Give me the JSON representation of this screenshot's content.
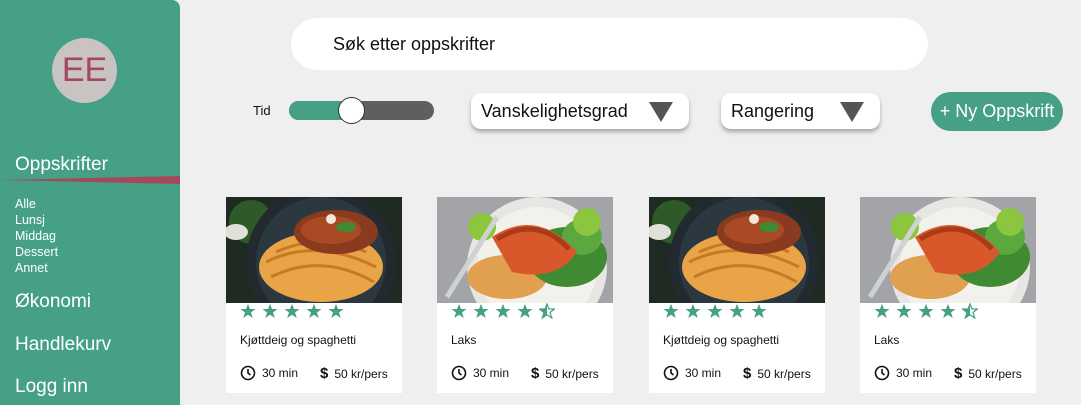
{
  "user": {
    "initials": "EE"
  },
  "colors": {
    "accent": "#45a085",
    "active_line": "#a6485c",
    "avatar_bg": "#c9c3c3"
  },
  "sidebar": {
    "main_items": [
      "Oppskrifter",
      "Økonomi",
      "Handlekurv",
      "Logg inn"
    ],
    "active": "Oppskrifter",
    "sub_items": [
      "Alle",
      "Lunsj",
      "Middag",
      "Dessert",
      "Annet"
    ]
  },
  "search": {
    "placeholder": "Søk etter oppskrifter"
  },
  "filters": {
    "time_label": "Tid",
    "time_slider_value": 0.43,
    "difficulty_label": "Vanskelighetsgrad",
    "rating_label": "Rangering"
  },
  "new_recipe_button": "+ Ny Oppskrift",
  "recipes": [
    {
      "title": "Kjøttdeig og spaghetti",
      "rating": 5,
      "time": "30 min",
      "price": "50 kr/pers",
      "image": "spaghetti-bolognese"
    },
    {
      "title": "Laks",
      "rating": 4.5,
      "time": "30 min",
      "price": "50 kr/pers",
      "image": "salmon-dish"
    },
    {
      "title": "Kjøttdeig og spaghetti",
      "rating": 5,
      "time": "30 min",
      "price": "50 kr/pers",
      "image": "spaghetti-bolognese"
    },
    {
      "title": "Laks",
      "rating": 4.5,
      "time": "30 min",
      "price": "50 kr/pers",
      "image": "salmon-dish"
    }
  ]
}
